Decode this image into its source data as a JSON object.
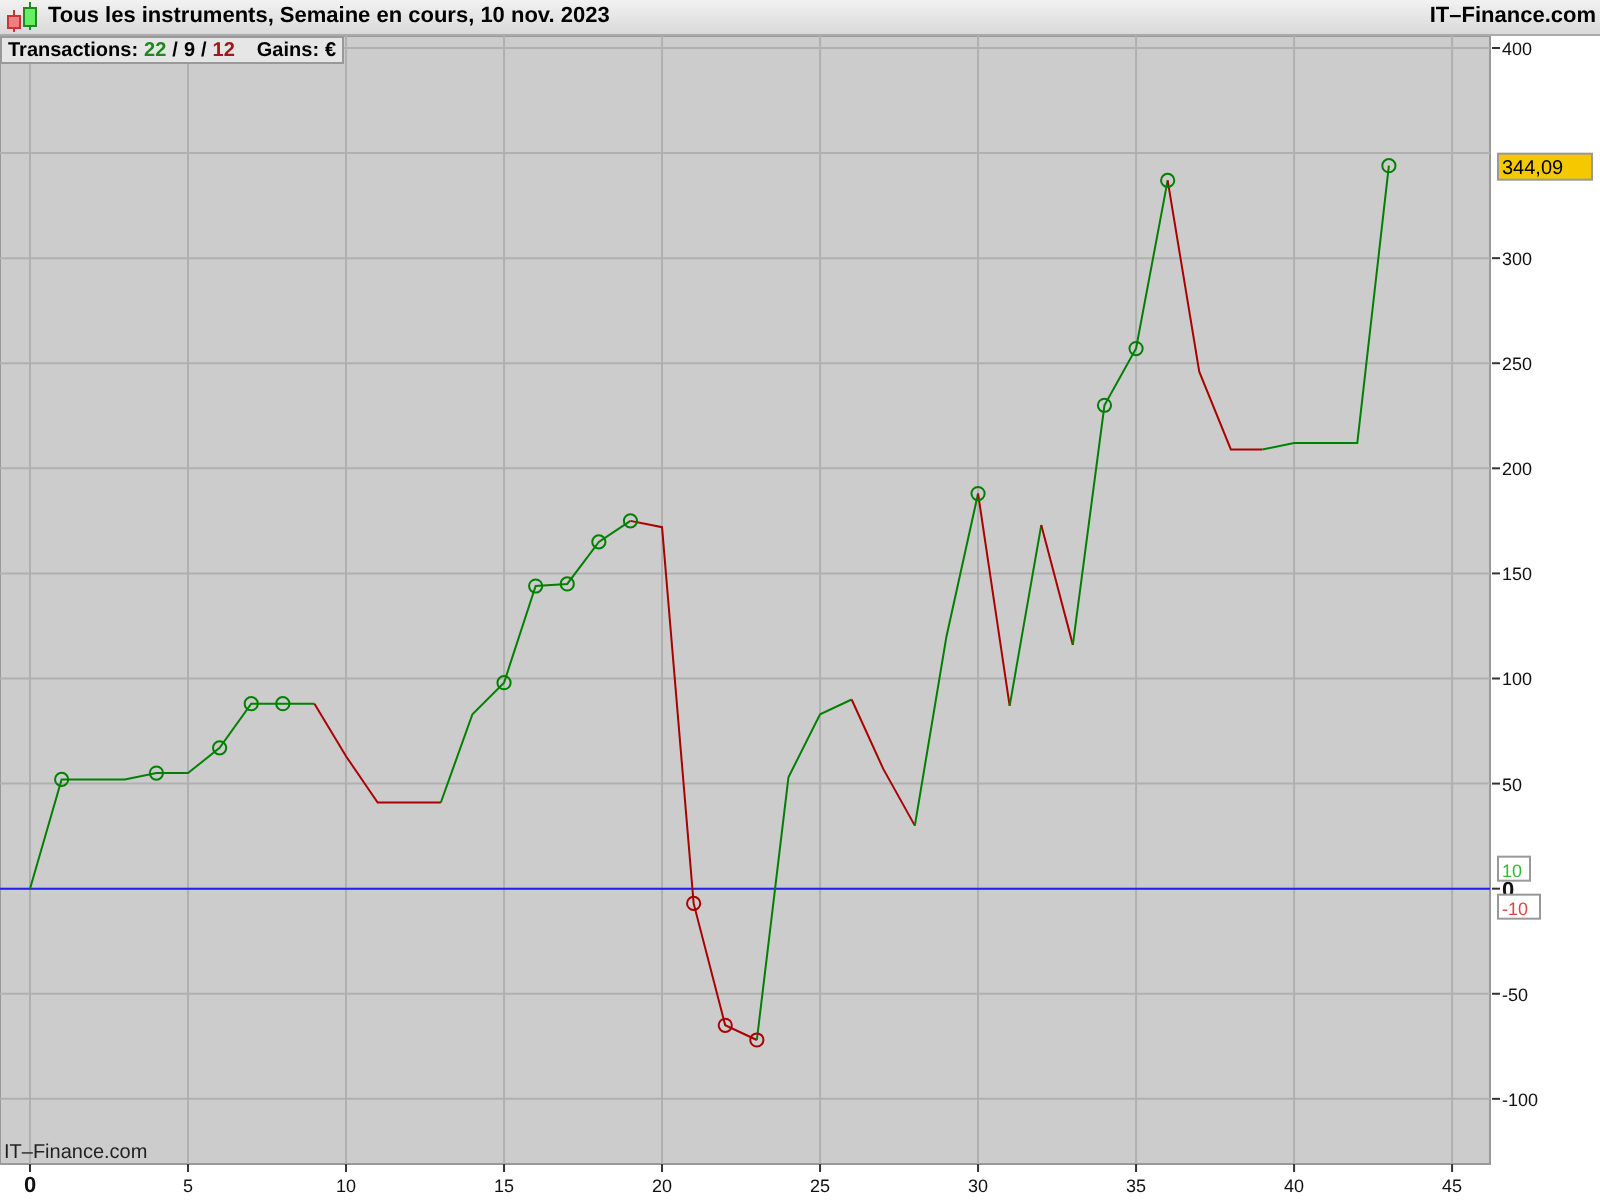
{
  "window": {
    "title": "Tous les instruments, Semaine en cours, 10 nov. 2023",
    "brand": "IT–Finance.com"
  },
  "stats": {
    "label": "Transactions:",
    "total": "22",
    "sep1": "/",
    "wins": "9",
    "sep2": "/",
    "losses": "12",
    "gains_label": "Gains:",
    "currency": "€"
  },
  "chart": {
    "watermark": "IT–Finance.com",
    "last_value": "344,09",
    "zero_badges": [
      {
        "text": "10",
        "color": "#33bb33"
      },
      {
        "text": "-10",
        "color": "#dd4444"
      }
    ],
    "marked": [
      false,
      true,
      false,
      false,
      true,
      false,
      true,
      true,
      true,
      false,
      false,
      false,
      false,
      false,
      false,
      true,
      true,
      true,
      true,
      true,
      false,
      true,
      true,
      true,
      false,
      false,
      false,
      false,
      false,
      false,
      true,
      false,
      false,
      false,
      true,
      true,
      true,
      false,
      false,
      false,
      false,
      false,
      false,
      true
    ],
    "chart_data": {
      "type": "line",
      "x": [
        0,
        1,
        2,
        3,
        4,
        5,
        6,
        7,
        8,
        9,
        10,
        11,
        12,
        13,
        14,
        15,
        16,
        17,
        18,
        19,
        20,
        21,
        22,
        23,
        24,
        25,
        26,
        27,
        28,
        29,
        30,
        31,
        32,
        33,
        34,
        35,
        36,
        37,
        38,
        39,
        40,
        41,
        42,
        43
      ],
      "series": [
        {
          "color": "#008000",
          "values": [
            0,
            52,
            52,
            52,
            55,
            55,
            67,
            88,
            88,
            88,
            null,
            null,
            null,
            null,
            null,
            null,
            null,
            null,
            null,
            null,
            null,
            null,
            null,
            null,
            null,
            null,
            null,
            null,
            null,
            null,
            null,
            null,
            null,
            null,
            null,
            null,
            null,
            null,
            null,
            null,
            null,
            null,
            null,
            null
          ]
        },
        {
          "color": "#aa0000",
          "values": [
            null,
            null,
            null,
            null,
            null,
            null,
            null,
            null,
            null,
            88,
            63,
            41,
            41,
            41,
            null,
            null,
            null,
            null,
            null,
            null,
            null,
            null,
            null,
            null,
            null,
            null,
            null,
            null,
            null,
            null,
            null,
            null,
            null,
            null,
            null,
            null,
            null,
            null,
            null,
            null,
            null,
            null,
            null,
            null
          ]
        },
        {
          "color": "#008000",
          "values": [
            null,
            null,
            null,
            null,
            null,
            null,
            null,
            null,
            null,
            null,
            null,
            null,
            null,
            41,
            83,
            98,
            144,
            145,
            165,
            175,
            null,
            null,
            null,
            null,
            null,
            null,
            null,
            null,
            null,
            null,
            null,
            null,
            null,
            null,
            null,
            null,
            null,
            null,
            null,
            null,
            null,
            null,
            null,
            null
          ]
        },
        {
          "color": "#aa0000",
          "values": [
            null,
            null,
            null,
            null,
            null,
            null,
            null,
            null,
            null,
            null,
            null,
            null,
            null,
            null,
            null,
            null,
            null,
            null,
            null,
            175,
            172,
            -7,
            -65,
            -72,
            null,
            null,
            null,
            null,
            null,
            null,
            null,
            null,
            null,
            null,
            null,
            null,
            null,
            null,
            null,
            null,
            null,
            null,
            null,
            null
          ]
        },
        {
          "color": "#008000",
          "values": [
            null,
            null,
            null,
            null,
            null,
            null,
            null,
            null,
            null,
            null,
            null,
            null,
            null,
            null,
            null,
            null,
            null,
            null,
            null,
            null,
            null,
            null,
            null,
            -72,
            53,
            83,
            90,
            null,
            null,
            null,
            null,
            null,
            null,
            null,
            null,
            null,
            null,
            null,
            null,
            null,
            null,
            null,
            null,
            null
          ]
        },
        {
          "color": "#aa0000",
          "values": [
            null,
            null,
            null,
            null,
            null,
            null,
            null,
            null,
            null,
            null,
            null,
            null,
            null,
            null,
            null,
            null,
            null,
            null,
            null,
            null,
            null,
            null,
            null,
            null,
            null,
            null,
            90,
            57,
            30,
            null,
            null,
            null,
            null,
            null,
            null,
            null,
            null,
            null,
            null,
            null,
            null,
            null,
            null,
            null
          ]
        },
        {
          "color": "#008000",
          "values": [
            null,
            null,
            null,
            null,
            null,
            null,
            null,
            null,
            null,
            null,
            null,
            null,
            null,
            null,
            null,
            null,
            null,
            null,
            null,
            null,
            null,
            null,
            null,
            null,
            null,
            null,
            null,
            null,
            30,
            120,
            188,
            null,
            null,
            null,
            null,
            null,
            null,
            null,
            null,
            null,
            null,
            null,
            null,
            null
          ]
        },
        {
          "color": "#aa0000",
          "values": [
            null,
            null,
            null,
            null,
            null,
            null,
            null,
            null,
            null,
            null,
            null,
            null,
            null,
            null,
            null,
            null,
            null,
            null,
            null,
            null,
            null,
            null,
            null,
            null,
            null,
            null,
            null,
            null,
            null,
            null,
            188,
            87,
            null,
            null,
            null,
            null,
            null,
            null,
            null,
            null,
            null,
            null,
            null,
            null
          ]
        },
        {
          "color": "#008000",
          "values": [
            null,
            null,
            null,
            null,
            null,
            null,
            null,
            null,
            null,
            null,
            null,
            null,
            null,
            null,
            null,
            null,
            null,
            null,
            null,
            null,
            null,
            null,
            null,
            null,
            null,
            null,
            null,
            null,
            null,
            null,
            null,
            87,
            173,
            null,
            null,
            null,
            null,
            null,
            null,
            null,
            null,
            null,
            null,
            null
          ]
        },
        {
          "color": "#aa0000",
          "values": [
            null,
            null,
            null,
            null,
            null,
            null,
            null,
            null,
            null,
            null,
            null,
            null,
            null,
            null,
            null,
            null,
            null,
            null,
            null,
            null,
            null,
            null,
            null,
            null,
            null,
            null,
            null,
            null,
            null,
            null,
            null,
            null,
            173,
            116,
            null,
            null,
            null,
            null,
            null,
            null,
            null,
            null,
            null,
            null
          ]
        },
        {
          "color": "#008000",
          "values": [
            null,
            null,
            null,
            null,
            null,
            null,
            null,
            null,
            null,
            null,
            null,
            null,
            null,
            null,
            null,
            null,
            null,
            null,
            null,
            null,
            null,
            null,
            null,
            null,
            null,
            null,
            null,
            null,
            null,
            null,
            null,
            null,
            null,
            116,
            230,
            257,
            337,
            null,
            null,
            null,
            null,
            null,
            null,
            null
          ]
        },
        {
          "color": "#aa0000",
          "values": [
            null,
            null,
            null,
            null,
            null,
            null,
            null,
            null,
            null,
            null,
            null,
            null,
            null,
            null,
            null,
            null,
            null,
            null,
            null,
            null,
            null,
            null,
            null,
            null,
            null,
            null,
            null,
            null,
            null,
            null,
            null,
            null,
            null,
            null,
            null,
            null,
            337,
            246,
            209,
            209,
            null,
            null,
            null,
            null
          ]
        },
        {
          "color": "#008000",
          "values": [
            null,
            null,
            null,
            null,
            null,
            null,
            null,
            null,
            null,
            null,
            null,
            null,
            null,
            null,
            null,
            null,
            null,
            null,
            null,
            null,
            null,
            null,
            null,
            null,
            null,
            null,
            null,
            null,
            null,
            null,
            null,
            null,
            null,
            null,
            null,
            null,
            null,
            null,
            null,
            209,
            212,
            212,
            212,
            344
          ]
        }
      ],
      "xlim": [
        -0.95,
        46.2
      ],
      "ylim": [
        -131,
        405.7
      ],
      "xticks": [
        {
          "value": 0,
          "label": "0"
        },
        5,
        10,
        15,
        20,
        25,
        30,
        35,
        40,
        45
      ],
      "yticks": [
        400,
        300,
        250,
        200,
        150,
        100,
        50,
        {
          "value": 0,
          "label": "0"
        },
        -50,
        -100
      ],
      "grid": true,
      "ref_lines": [
        {
          "axis": "y",
          "value": 0,
          "color": "#2222ee"
        }
      ]
    }
  }
}
